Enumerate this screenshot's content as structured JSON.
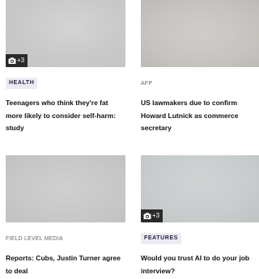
{
  "cards": [
    {
      "gallery_count": "+3",
      "tag": "HEALTH",
      "headline": "Teenagers who think they're fat more likely to consider self-harm: study"
    },
    {
      "source": "AFP",
      "headline": "US lawmakers due to confirm Howard Lutnick as commerce secretary"
    },
    {
      "source": "FIELD LEVEL MEDIA",
      "headline": "Reports: Cubs, Justin Turner agree to deal"
    },
    {
      "gallery_count": "+3",
      "tag": "FEATURES",
      "headline": "Would you trust AI to do your job interview?"
    }
  ],
  "colors": {
    "badge_bg": "#2a2a2a",
    "tag_bg": "#ecebf4",
    "tag_text": "#2a2040"
  },
  "icons": {
    "gallery": "camera-icon"
  }
}
